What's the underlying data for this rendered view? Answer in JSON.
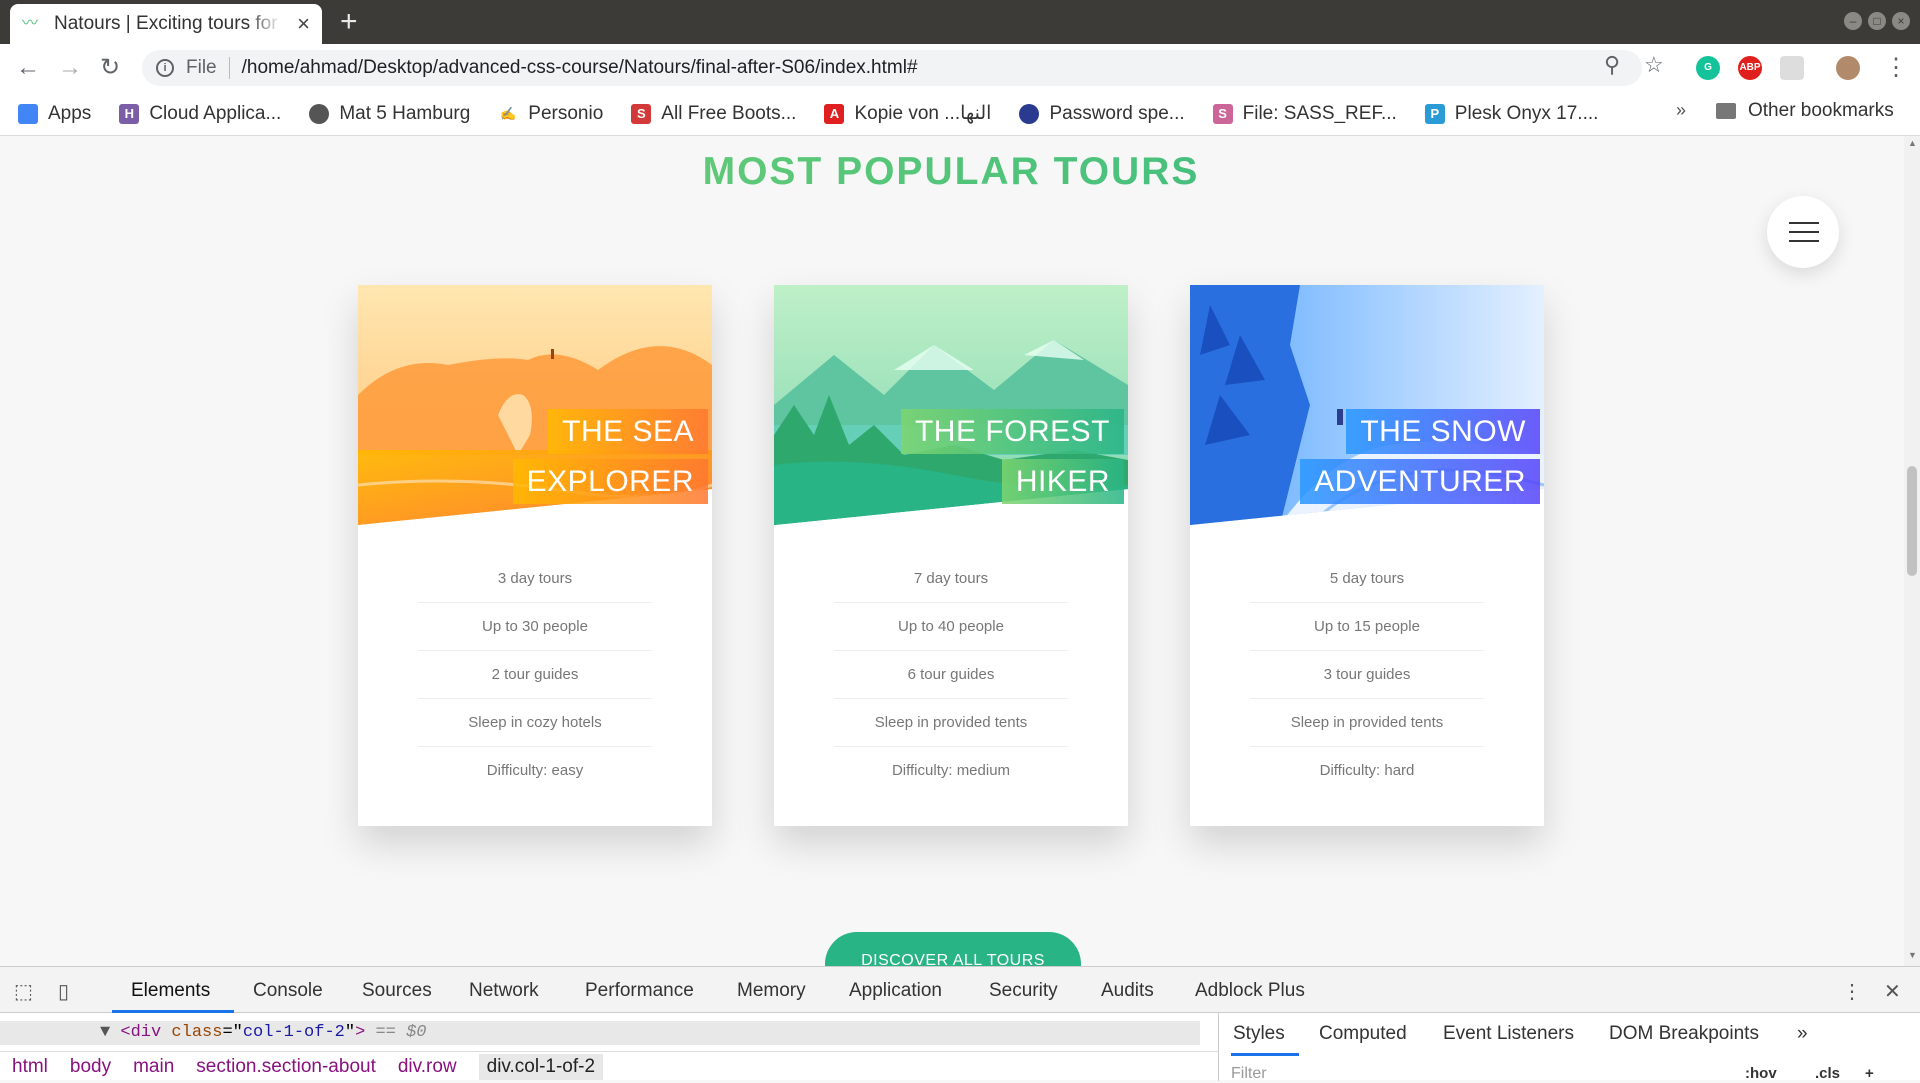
{
  "browser": {
    "tab_title": "Natours | Exciting tours for adventurous people",
    "url_scheme": "File",
    "url": "/home/ahmad/Desktop/advanced-css-course/Natours/final-after-S06/index.html#",
    "bookmarks": [
      {
        "label": "Apps",
        "icon": "apps-grid-icon",
        "color": "#4285f4"
      },
      {
        "label": "Cloud Applica...",
        "icon": "h-logo-icon",
        "color": "#7b5ea7"
      },
      {
        "label": "Mat 5 Hamburg",
        "icon": "globe-icon",
        "color": "#555555"
      },
      {
        "label": "Personio",
        "icon": "signature-icon",
        "color": "#444444"
      },
      {
        "label": "All Free Boots...",
        "icon": "s-logo-icon",
        "color": "#d23a3a"
      },
      {
        "label": "Kopie von ...النها",
        "icon": "pdf-icon",
        "color": "#e02020"
      },
      {
        "label": "Password spe...",
        "icon": "firefox-icon",
        "color": "#2a3b8f"
      },
      {
        "label": "File: SASS_REF...",
        "icon": "sass-icon",
        "color": "#cc6699"
      },
      {
        "label": "Plesk Onyx 17....",
        "icon": "plesk-icon",
        "color": "#2b9bd6"
      }
    ],
    "other_bookmarks": "Other bookmarks",
    "overflow": "»"
  },
  "page": {
    "section_title": "MOST POPULAR TOURS",
    "cta_label": "DISCOVER ALL TOURS",
    "colors": {
      "green_light": "#7ed56f",
      "green_dark": "#28b485",
      "orange_light": "#ffb900",
      "orange_dark": "#ff7730",
      "blue_light": "#2998ff",
      "blue_dark": "#5643fa"
    },
    "cards": [
      {
        "heading_line1": "THE SEA",
        "heading_line2": "EXPLORER",
        "details": [
          "3 day tours",
          "Up to 30 people",
          "2 tour guides",
          "Sleep in cozy hotels",
          "Difficulty: easy"
        ]
      },
      {
        "heading_line1": "THE FOREST",
        "heading_line2": "HIKER",
        "details": [
          "7 day tours",
          "Up to 40 people",
          "6 tour guides",
          "Sleep in provided tents",
          "Difficulty: medium"
        ]
      },
      {
        "heading_line1": "THE SNOW",
        "heading_line2": "ADVENTURER",
        "details": [
          "5 day tours",
          "Up to 15 people",
          "3 tour guides",
          "Sleep in provided tents",
          "Difficulty: hard"
        ]
      }
    ]
  },
  "devtools": {
    "tabs": [
      "Elements",
      "Console",
      "Sources",
      "Network",
      "Performance",
      "Memory",
      "Application",
      "Security",
      "Audits",
      "Adblock Plus"
    ],
    "selected_node": {
      "tag_open": "<div",
      "attr": "class",
      "value": "col-1-of-2",
      "close": ">",
      "suffix": "== $0"
    },
    "breadcrumbs": [
      "html",
      "body",
      "main",
      "section.section-about",
      "div.row",
      "div.col-1-of-2"
    ],
    "styles_tabs": [
      "Styles",
      "Computed",
      "Event Listeners",
      "DOM Breakpoints"
    ],
    "filter_placeholder": "Filter",
    "hov": ":hov",
    "cls": ".cls"
  }
}
